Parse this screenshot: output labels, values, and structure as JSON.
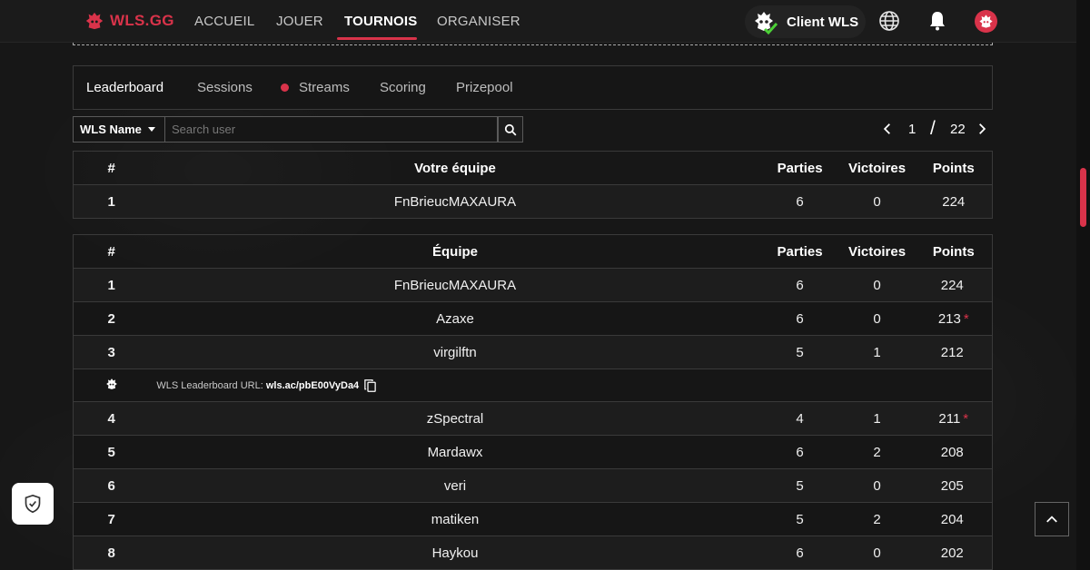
{
  "brand": {
    "name": "WLS.GG",
    "accent": "#d9334a"
  },
  "nav": {
    "links": [
      "ACCUEIL",
      "JOUER",
      "TOURNOIS",
      "ORGANISER"
    ],
    "active": "TOURNOIS",
    "client_label": "Client WLS"
  },
  "tabs": {
    "items": [
      "Leaderboard",
      "Sessions",
      "Streams",
      "Scoring",
      "Prizepool"
    ],
    "active": "Leaderboard"
  },
  "search": {
    "filter_value": "WLS Name",
    "placeholder": "Search user"
  },
  "pager": {
    "current": "1",
    "separator": "/",
    "total": "22"
  },
  "my_team": {
    "headers": [
      "#",
      "Votre équipe",
      "Parties",
      "Victoires",
      "Points"
    ],
    "row": {
      "rank": "1",
      "team": "FnBrieucMAXAURA",
      "parties": "6",
      "victoires": "0",
      "points": "224"
    }
  },
  "leaderboard": {
    "headers": [
      "#",
      "Équipe",
      "Parties",
      "Victoires",
      "Points"
    ],
    "rows": [
      {
        "rank": "1",
        "team": "FnBrieucMAXAURA",
        "parties": "6",
        "victoires": "0",
        "points": "224",
        "star": ""
      },
      {
        "rank": "2",
        "team": "Azaxe",
        "parties": "6",
        "victoires": "0",
        "points": "213",
        "star": "*"
      },
      {
        "rank": "3",
        "team": "virgilftn",
        "parties": "5",
        "victoires": "1",
        "points": "212",
        "star": ""
      },
      {
        "rank": "4",
        "team": "zSpectral",
        "parties": "4",
        "victoires": "1",
        "points": "211",
        "star": "*"
      },
      {
        "rank": "5",
        "team": "Mardawx",
        "parties": "6",
        "victoires": "2",
        "points": "208",
        "star": ""
      },
      {
        "rank": "6",
        "team": "veri",
        "parties": "5",
        "victoires": "0",
        "points": "205",
        "star": ""
      },
      {
        "rank": "7",
        "team": "matiken",
        "parties": "5",
        "victoires": "2",
        "points": "204",
        "star": ""
      },
      {
        "rank": "8",
        "team": "Haykou",
        "parties": "6",
        "victoires": "0",
        "points": "202",
        "star": ""
      }
    ],
    "url_row": {
      "label": "WLS Leaderboard URL:",
      "url": "wls.ac/pbE00VyDa4"
    }
  }
}
